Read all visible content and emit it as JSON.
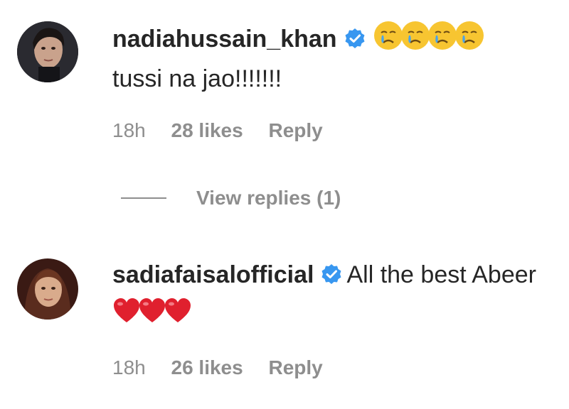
{
  "comments": [
    {
      "username": "nadiahussain_khan",
      "verified": true,
      "text": "tussi na jao!!!!!!!",
      "time": "18h",
      "likes": "28 likes",
      "reply_label": "Reply",
      "view_replies_label": "View replies (1)"
    },
    {
      "username": "sadiafaisalofficial",
      "verified": true,
      "text": "All the best Abeer",
      "time": "18h",
      "likes": "26 likes",
      "reply_label": "Reply"
    }
  ],
  "icons": {
    "verified": "verified-badge-icon",
    "crying_emoji": "crying-face-emoji",
    "heart_emoji": "red-heart-emoji"
  },
  "colors": {
    "username": "#262626",
    "meta": "#8e8e8e",
    "verified_blue": "#3897f0",
    "heart_red": "#e0202e"
  }
}
